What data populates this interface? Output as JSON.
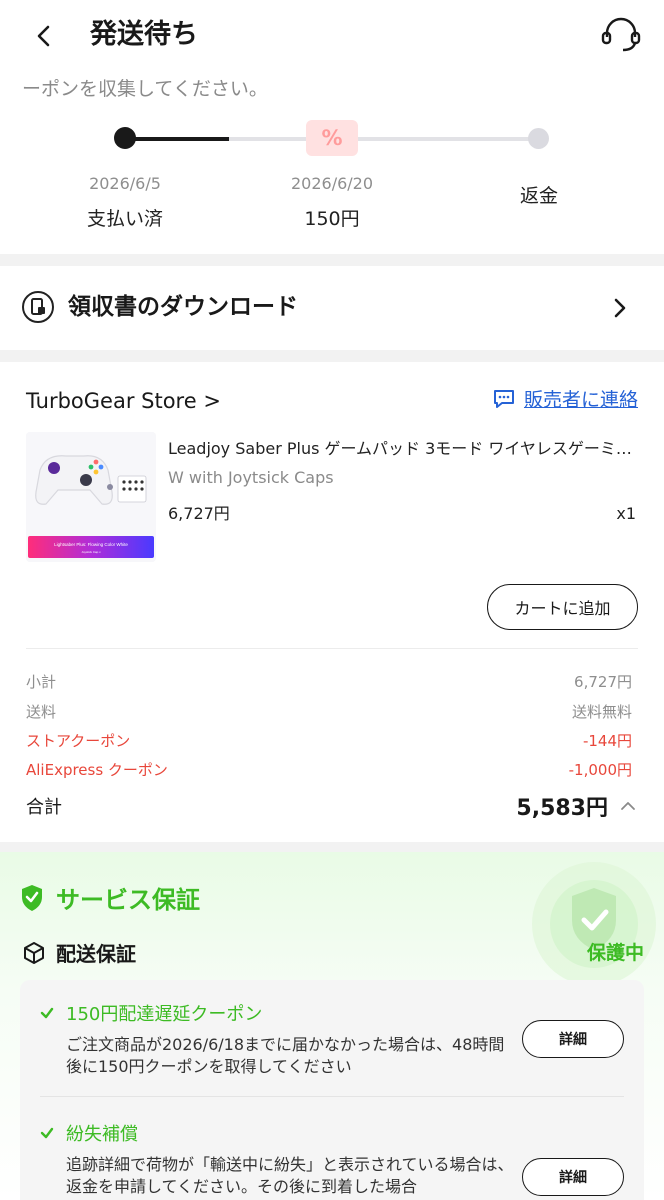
{
  "header": {
    "title": "発送待ち"
  },
  "progress": {
    "hint": "ーポンを収集してください。",
    "steps": [
      {
        "date": "2026/6/5",
        "label": "支払い済"
      },
      {
        "date": "2026/6/20",
        "label": "150円"
      },
      {
        "date": "",
        "label": "返金"
      }
    ],
    "badge_symbol": "%"
  },
  "receipt": {
    "label": "領収書のダウンロード"
  },
  "order": {
    "store_name": "TurboGear Store",
    "store_chevron": ">",
    "contact_label": "販売者に連絡",
    "product": {
      "title": "Leadjoy Saber Plus ゲームパッド 3モード ワイヤレスゲーミ…",
      "variant": "W with Joytsick Caps",
      "price": "6,727円",
      "qty": "x1",
      "image_banner_text": "Lightsaber Plus: Flowing Color White",
      "image_banner_sub": "Joystick Cap x"
    },
    "add_to_cart_label": "カートに追加",
    "summary": [
      {
        "label": "小計",
        "value": "6,727円",
        "type": "normal"
      },
      {
        "label": "送料",
        "value": "送料無料",
        "type": "normal"
      },
      {
        "label": "ストアクーポン",
        "value": "-144円",
        "type": "discount"
      },
      {
        "label": "AliExpress クーポン",
        "value": "-1,000円",
        "type": "discount"
      }
    ],
    "total_label": "合計",
    "total_value": "5,583円"
  },
  "service": {
    "title": "サービス保証",
    "protect_label": "保護中",
    "shipping_title": "配送保証",
    "items": [
      {
        "title": "150円配達遅延クーポン",
        "desc": "ご注文商品が2026/6/18までに届かなかった場合は、48時間後に150円クーポンを取得してください",
        "button": "詳細"
      },
      {
        "title": "紛失補償",
        "desc": "追跡詳細で荷物が「輸送中に紛失」と表示されている場合は、返金を申請してください。その後に到着した場合",
        "button": "詳細"
      }
    ]
  },
  "colors": {
    "accent_green": "#3dbb24",
    "link_blue": "#2562d6",
    "discount_red": "#e8473b",
    "coupon_pink": "#ffe1e1"
  },
  "icons": [
    "back-arrow-icon",
    "headset-icon",
    "receipt-icon",
    "chevron-right-icon",
    "chat-icon",
    "chevron-up-icon",
    "shield-check-icon",
    "box-icon",
    "check-icon"
  ]
}
